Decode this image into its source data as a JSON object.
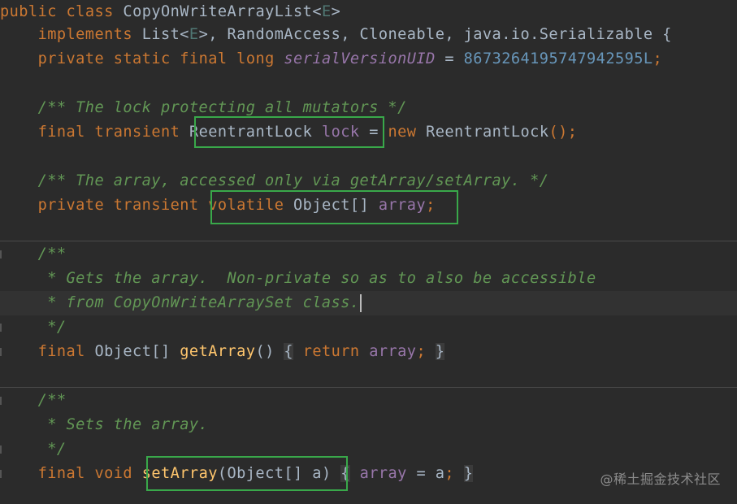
{
  "editor": {
    "lines": {
      "l1": {
        "public": "public",
        "class": "class",
        "name": "CopyOnWriteArrayList",
        "lt": "<",
        "E": "E",
        "gt": ">"
      },
      "l2": {
        "implements": "implements",
        "list": "List",
        "lt": "<",
        "E": "E",
        "rest": ">, RandomAccess, Cloneable, java.io.Serializable {"
      },
      "l3": {
        "private": "private",
        "static": "static",
        "final": "final",
        "long": "long",
        "uid": "serialVersionUID",
        "eq": " = ",
        "num": "8673264195747942595L",
        "semi": ";"
      },
      "l5": {
        "comment": "/** The lock protecting all mutators */"
      },
      "l6": {
        "final": "final",
        "transient": "transient",
        "type": "ReentrantLock",
        "field": "lock",
        "eq": " = ",
        "new": "new",
        "ctor": "ReentrantLock",
        "tail": "();"
      },
      "l8": {
        "comment": "/** The array, accessed only via getArray/setArray. */"
      },
      "l9": {
        "private": "private",
        "transient": "transient",
        "volatile": "volatile",
        "type": "Object[]",
        "field": "array",
        "semi": ";"
      },
      "l11": {
        "comment": "/**"
      },
      "l12": {
        "comment": " * Gets the array.  Non-private so as to also be accessible"
      },
      "l13": {
        "comment": " * from CopyOnWriteArraySet class."
      },
      "l14": {
        "comment": " */"
      },
      "l15": {
        "final": "final",
        "type": "Object[]",
        "method": "getArray",
        "parens": "()",
        "open": "{",
        "return": "return",
        "field": "array",
        "semi": ";",
        "close": "}"
      },
      "l17": {
        "comment": "/**"
      },
      "l18": {
        "comment": " * Sets the array."
      },
      "l19": {
        "comment": " */"
      },
      "l20": {
        "final": "final",
        "void": "void",
        "method": "setArray",
        "params": "(Object[] a)",
        "open": "{",
        "field": "array",
        "assign": " = a",
        "semi": ";",
        "close": "}"
      }
    }
  },
  "watermark": "@稀土掘金技术社区",
  "colors": {
    "background": "#2b2b2b",
    "keyword": "#cc7832",
    "field": "#9876aa",
    "doc_comment": "#629755",
    "method": "#ffc66d",
    "number": "#6897bb",
    "highlight_box": "#39a84a"
  }
}
